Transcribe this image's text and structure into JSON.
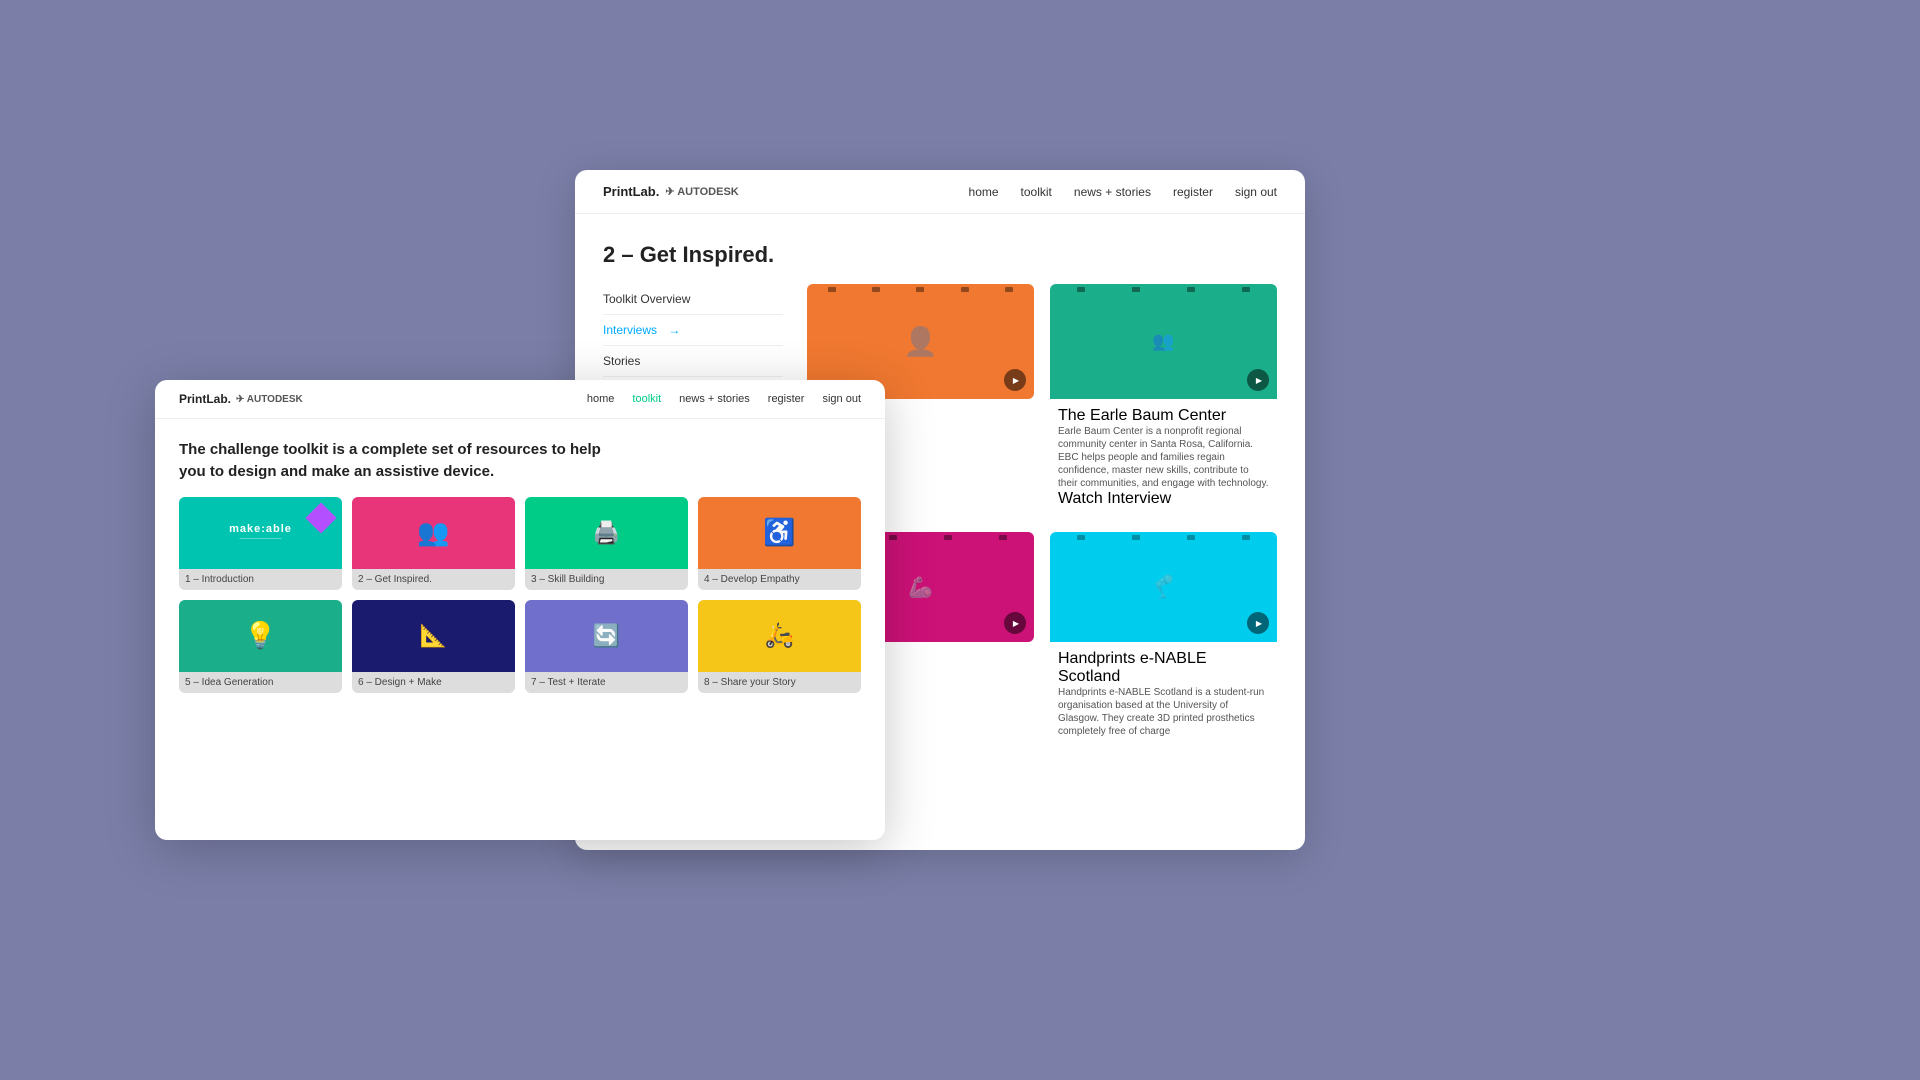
{
  "back_window": {
    "nav": {
      "logo": "PrintLab.",
      "autodesk": "✈ AUTODESK",
      "links": [
        "home",
        "toolkit",
        "news + stories",
        "register",
        "sign out"
      ]
    },
    "page_title": "2 – Get Inspired.",
    "sidebar": {
      "items": [
        {
          "label": "Toolkit Overview",
          "active": false
        },
        {
          "label": "Interviews",
          "active": true
        },
        {
          "label": "Stories",
          "active": false
        }
      ]
    },
    "cards_row1": [
      {
        "id": "baum",
        "title": "The Earle Baum Center",
        "desc": "Earle Baum Center is a nonprofit regional community center in Santa Rosa, California. EBC helps people and families regain confidence, master new skills, contribute to their communities, and engage with technology.",
        "btn": "Watch Interview",
        "color": "#1aaf8a"
      }
    ],
    "cards_row2": [
      {
        "id": "handprints",
        "title": "Handprints e-NABLE Scotland",
        "desc": "Handprints e-NABLE Scotland is a student-run organisation based at the University of Glasgow. They create 3D printed prosthetics completely free of charge",
        "color": "#00ccee"
      }
    ],
    "news_label": "news stories"
  },
  "front_window": {
    "nav": {
      "logo": "PrintLab.",
      "autodesk": "✈ AUTODESK",
      "links": [
        {
          "label": "home",
          "active": false
        },
        {
          "label": "toolkit",
          "active": true
        },
        {
          "label": "news + stories",
          "active": false
        },
        {
          "label": "register",
          "active": false
        },
        {
          "label": "sign out",
          "active": false
        }
      ]
    },
    "hero_text": "The challenge toolkit is a complete set of resources to help you to design and make an assistive device.",
    "cards_row1": [
      {
        "label": "1 – Introduction",
        "color": "#00c4b0",
        "icon": "makeable"
      },
      {
        "label": "2 – Get Inspired.",
        "color": "#e8357a",
        "icon": "people"
      },
      {
        "label": "3 – Skill Building",
        "color": "#00cc88",
        "icon": "printer"
      },
      {
        "label": "4 – Develop Empathy",
        "color": "#f07830",
        "icon": "wheelchair"
      }
    ],
    "cards_row2": [
      {
        "label": "5 – Idea Generation",
        "color": "#1aaf8a",
        "icon": "bulb"
      },
      {
        "label": "6 – Design + Make",
        "color": "#1a1a6e",
        "icon": "blueprint"
      },
      {
        "label": "7 – Test + Iterate",
        "color": "#7070cc",
        "icon": "mountain"
      },
      {
        "label": "8 – Share your Story",
        "color": "#f5c518",
        "icon": "scooter"
      }
    ]
  }
}
